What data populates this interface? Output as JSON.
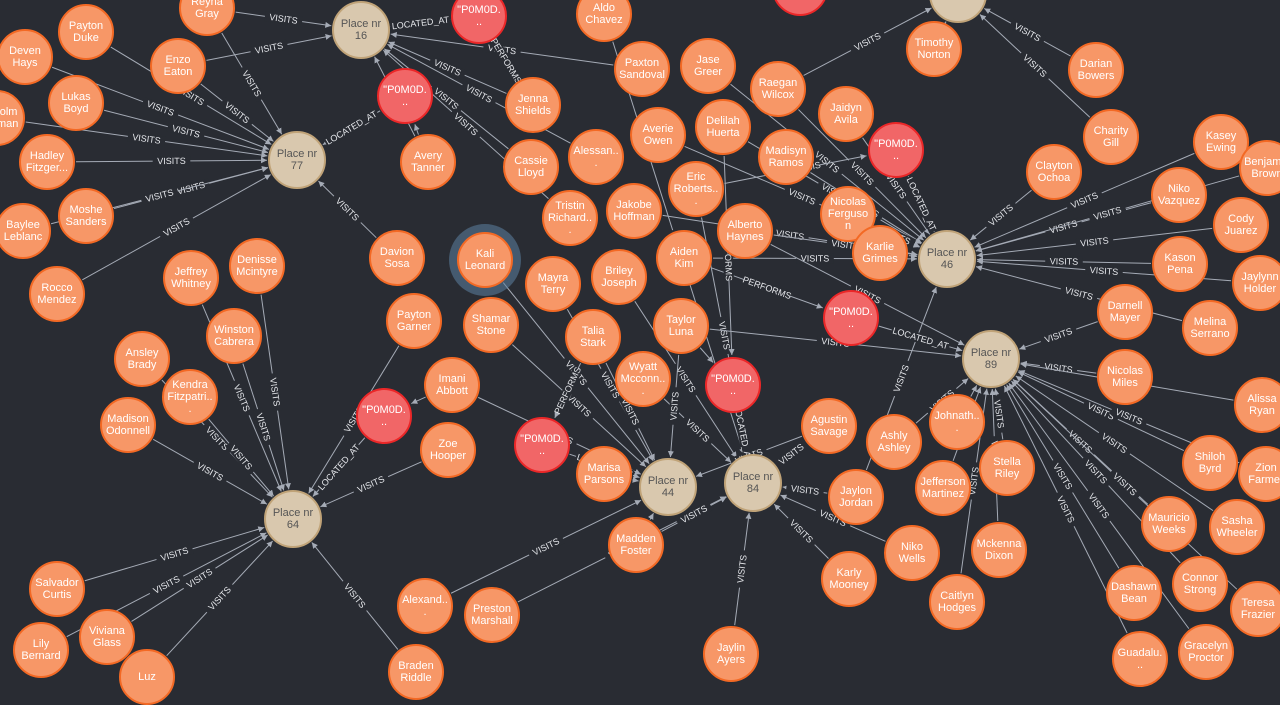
{
  "graph": {
    "colors": {
      "background": "#292c33",
      "person": "#f79767",
      "person_border": "#f36924",
      "place": "#d9c8ae",
      "place_border": "#c0a378",
      "performance": "#f16667",
      "performance_border": "#eb2728",
      "edge": "#a5abb6",
      "selected_ring": "#5c81a0"
    },
    "edge_labels": {
      "visits": "VISITS",
      "located_at": "LOCATED_AT",
      "located_trunc": "LOCATE...",
      "performs": "PERFORMS"
    },
    "places": [
      {
        "id": "p16",
        "label": "Place nr\n16"
      },
      {
        "id": "p77",
        "label": "Place nr\n77"
      },
      {
        "id": "p64",
        "label": "Place nr\n64"
      },
      {
        "id": "p44",
        "label": "Place nr\n44"
      },
      {
        "id": "p84",
        "label": "Place nr\n84"
      },
      {
        "id": "p46",
        "label": "Place nr\n46"
      },
      {
        "id": "p89",
        "label": "Place nr\n89"
      },
      {
        "id": "ptop",
        "label": ""
      }
    ],
    "performances": [
      {
        "id": "f1",
        "label": "\"P0M0D..."
      },
      {
        "id": "f2",
        "label": "\"P0M0D..."
      },
      {
        "id": "f3",
        "label": "\"P0M0D..."
      },
      {
        "id": "f4",
        "label": "\"P0M0D..."
      },
      {
        "id": "f5",
        "label": "\"P0M0D..."
      },
      {
        "id": "f6",
        "label": "\"P0M0D..."
      },
      {
        "id": "f7",
        "label": "\"P0M0D..."
      },
      {
        "id": "f8",
        "label": ""
      }
    ],
    "people": [
      "Reyna Gray",
      "Payton Duke",
      "Deven Hays",
      "Enzo Eaton",
      "Lukas Boyd",
      "Malcolm Bowman",
      "Hadley Fitzger...",
      "Moshe Sanders",
      "Baylee Leblanc",
      "Rocco Mendez",
      "Jeffrey Whitney",
      "Denisse Mcintyre",
      "Winston Cabrera",
      "Ansley Brady",
      "Kendra Fitzpatri...",
      "Madison Odonnell",
      "Salvador Curtis",
      "Viviana Glass",
      "Lily Bernard",
      "Luz",
      "Aldo Chavez",
      "Jenna Shields",
      "Avery Tanner",
      "Cassie Lloyd",
      "Alessan...",
      "Tristin Richard...",
      "Jakobe Hoffman",
      "Paxton Sandoval",
      "Jase Greer",
      "Averie Owen",
      "Delilah Huerta",
      "Raegan Wilcox",
      "Jaidyn Avila",
      "Madisyn Ramos",
      "Eric Roberts...",
      "Alberto Haynes",
      "Aiden Kim",
      "Nicolas Ferguson",
      "Karlie Grimes",
      "Timothy Norton",
      "Davion Sosa",
      "Kali Leonard",
      "Mayra Terry",
      "Briley Joseph",
      "Payton Garner",
      "Shamar Stone",
      "Talia Stark",
      "Taylor Luna",
      "Imani Abbott",
      "Wyatt Mcconn...",
      "Zoe Hooper",
      "Marisa Parsons",
      "Madden Foster",
      "Alexand...",
      "Preston Marshall",
      "Braden Riddle",
      "Jaylin Ayers",
      "Agustin Savage",
      "Ashly Ashley",
      "Johnath...",
      "Jaylon Jordan",
      "Jefferson Martinez",
      "Stella Riley",
      "Niko Wells",
      "Mckenna Dixon",
      "Karly Mooney",
      "Caitlyn Hodges",
      "Darian Bowers",
      "Charity Gill",
      "Clayton Ochoa",
      "Kasey Ewing",
      "Niko Vazquez",
      "Benjamin Brown",
      "Cody Juarez",
      "Kason Pena",
      "Jaylynn Holder",
      "Darnell Mayer",
      "Melina Serrano",
      "Nicolas Miles",
      "Alissa Ryan",
      "Shiloh Byrd",
      "Zion Farmer",
      "Mauricio Weeks",
      "Sasha Wheeler",
      "Connor Strong",
      "Teresa Frazier",
      "Dashawn Bean",
      "Gracelyn Proctor",
      "Guadalu..."
    ]
  }
}
